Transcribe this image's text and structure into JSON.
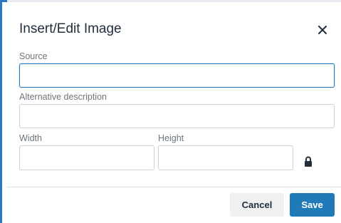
{
  "dialog": {
    "title": "Insert/Edit Image",
    "close_icon": "close-icon"
  },
  "fields": {
    "source": {
      "label": "Source",
      "value": ""
    },
    "alt": {
      "label": "Alternative description",
      "value": ""
    },
    "width": {
      "label": "Width",
      "value": ""
    },
    "height": {
      "label": "Height",
      "value": ""
    },
    "constrain_icon": "lock-icon"
  },
  "footer": {
    "cancel_label": "Cancel",
    "save_label": "Save"
  },
  "colors": {
    "accent": "#207ab7",
    "text": "#222f3e",
    "label": "#6c757d",
    "border": "#ccd1d6"
  }
}
